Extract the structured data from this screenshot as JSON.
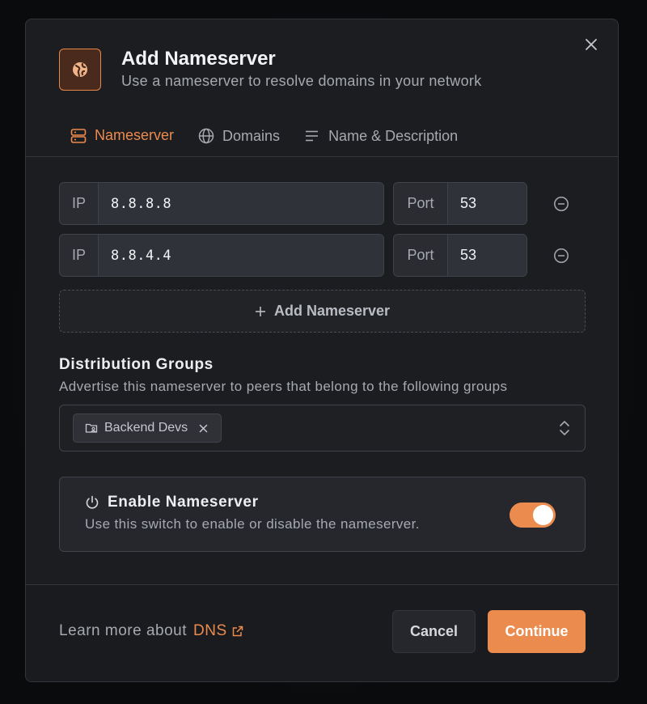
{
  "dialog": {
    "title": "Add Nameserver",
    "subtitle": "Use a nameserver to resolve domains in your network",
    "header_icon": "globe-pin-icon"
  },
  "tabs": [
    {
      "label": "Nameserver",
      "icon": "server-icon",
      "active": true
    },
    {
      "label": "Domains",
      "icon": "globe-icon",
      "active": false
    },
    {
      "label": "Name & Description",
      "icon": "text-lines-icon",
      "active": false
    }
  ],
  "nameservers": [
    {
      "ip_label": "IP",
      "ip": "8.8.8.8",
      "port_label": "Port",
      "port": "53"
    },
    {
      "ip_label": "IP",
      "ip": "8.8.4.4",
      "port_label": "Port",
      "port": "53"
    }
  ],
  "add_nameserver_label": "Add Nameserver",
  "distribution": {
    "title": "Distribution Groups",
    "subtitle": "Advertise this nameserver to peers that belong to the following groups",
    "groups": [
      "Backend Devs"
    ]
  },
  "enable": {
    "title": "Enable Nameserver",
    "subtitle": "Use this switch to enable or disable the nameserver.",
    "enabled": true
  },
  "footer": {
    "learn_text": "Learn more about",
    "link_text": "DNS",
    "cancel_label": "Cancel",
    "continue_label": "Continue"
  },
  "colors": {
    "accent": "#ec8b4e",
    "background": "#1c1d21",
    "input_bg": "#30323a"
  }
}
